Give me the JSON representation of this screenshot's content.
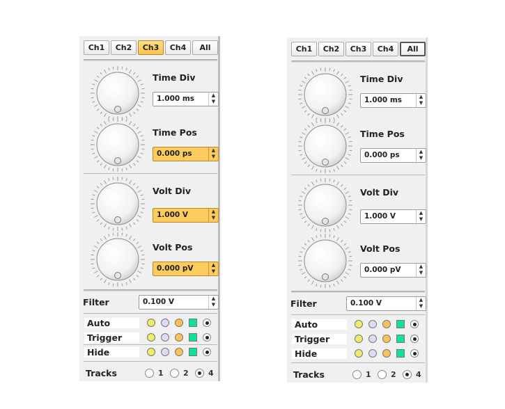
{
  "tabs": [
    "Ch1",
    "Ch2",
    "Ch3",
    "Ch4",
    "All"
  ],
  "panels": [
    {
      "active_tab": "Ch3",
      "controls": {
        "time_div": {
          "label": "Time Div",
          "value": "1.000 ms"
        },
        "time_pos": {
          "label": "Time Pos",
          "value": "0.000 ps"
        },
        "volt_div": {
          "label": "Volt Div",
          "value": "1.000 V"
        },
        "volt_pos": {
          "label": "Volt Pos",
          "value": "0.000 pV"
        }
      },
      "filter": {
        "label": "Filter",
        "value": "0.100 V"
      },
      "rows": [
        "Auto",
        "Trigger",
        "Hide"
      ],
      "tracks": {
        "label": "Tracks",
        "options": [
          "1",
          "2",
          "4"
        ],
        "selected": "4"
      }
    },
    {
      "active_tab": "All",
      "controls": {
        "time_div": {
          "label": "Time Div",
          "value": "1.000 ms"
        },
        "time_pos": {
          "label": "Time Pos",
          "value": "0.000 ps"
        },
        "volt_div": {
          "label": "Volt Div",
          "value": "1.000 V"
        },
        "volt_pos": {
          "label": "Volt Pos",
          "value": "0.000 pV"
        }
      },
      "filter": {
        "label": "Filter",
        "value": "0.100 V"
      },
      "rows": [
        "Auto",
        "Trigger",
        "Hide"
      ],
      "tracks": {
        "label": "Tracks",
        "options": [
          "1",
          "2",
          "4"
        ],
        "selected": "4"
      }
    }
  ],
  "colors": {
    "highlight": "#fdcc5e",
    "ch1": "#eded6a",
    "ch2": "#dcdcf4",
    "ch3": "#fbc25a",
    "ch4": "#10e09a"
  },
  "icons": {
    "knob": "rotary-knob-icon",
    "spin": "spinner-arrows-icon"
  }
}
